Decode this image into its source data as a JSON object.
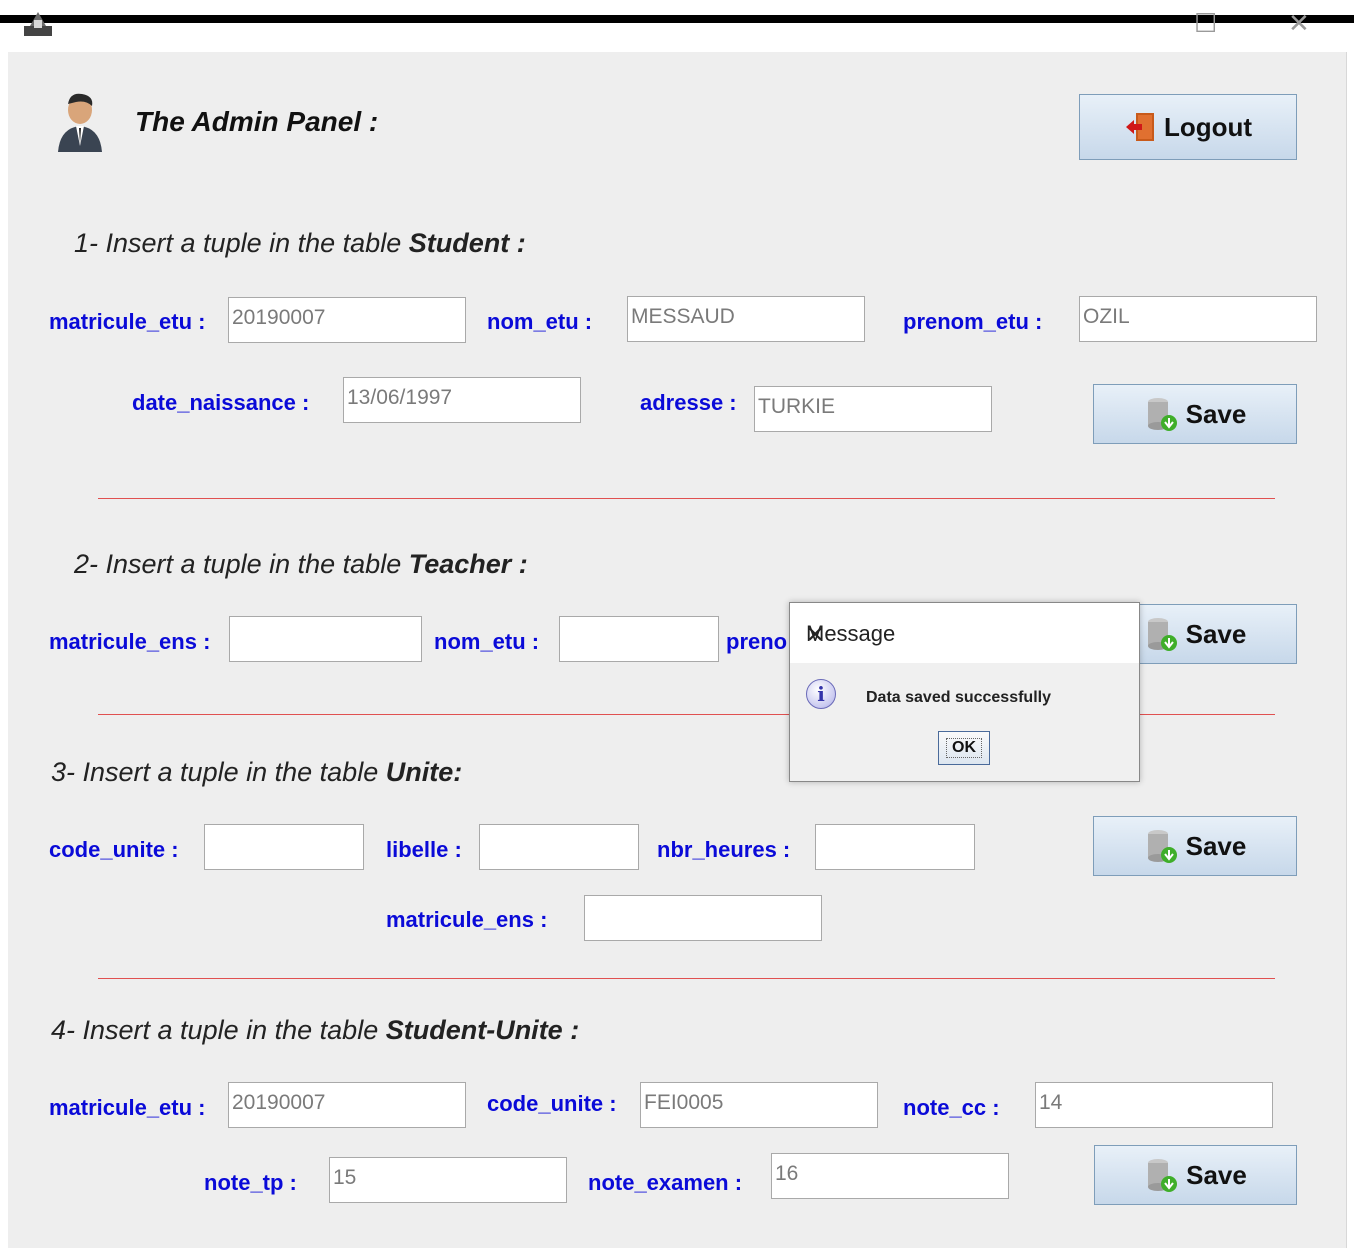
{
  "window": {
    "minimize_icon": "☐",
    "close_icon": "✕"
  },
  "header": {
    "title": "The Admin Panel  :",
    "logout_label": "Logout"
  },
  "student": {
    "section_prefix": "1- Insert a tuple in the table ",
    "section_table": "Student :",
    "matricule_label": "matricule_etu :",
    "matricule_value": "20190007",
    "nom_label": "nom_etu :",
    "nom_value": "MESSAUD",
    "prenom_label": "prenom_etu :",
    "prenom_value": "OZIL",
    "date_label": "date_naissance :",
    "date_value": "13/06/1997",
    "adresse_label": "adresse :",
    "adresse_value": "TURKIE",
    "save_label": "Save"
  },
  "teacher": {
    "section_prefix": "2- Insert a tuple in the table ",
    "section_table": "Teacher :",
    "matricule_label": "matricule_ens :",
    "matricule_value": "",
    "nom_label": "nom_etu :",
    "nom_value": "",
    "prenom_label_partial": "preno",
    "save_label": "Save"
  },
  "unite": {
    "section_prefix": "3- Insert a tuple in the table ",
    "section_table": "Unite:",
    "code_label": "code_unite :",
    "code_value": "",
    "libelle_label": "libelle :",
    "libelle_value": "",
    "nbr_label": "nbr_heures :",
    "nbr_value": "",
    "matricule_label": "matricule_ens :",
    "matricule_value": "",
    "save_label": "Save"
  },
  "student_unite": {
    "section_prefix": "4- Insert a tuple in the table ",
    "section_table": "Student-Unite :",
    "matricule_label": "matricule_etu :",
    "matricule_value": "20190007",
    "code_label": "code_unite :",
    "code_value": "FEI0005",
    "note_cc_label": "note_cc :",
    "note_cc_value": "14",
    "note_tp_label": "note_tp :",
    "note_tp_value": "15",
    "note_examen_label": "note_examen :",
    "note_examen_value": "16",
    "save_label": "Save"
  },
  "dialog": {
    "title": "Message",
    "close_icon": "✕",
    "info_icon": "i",
    "message": "Data saved successfully",
    "ok_label": "OK"
  },
  "colors": {
    "label": "#0a0ad8",
    "separator": "#e05050",
    "panel": "#eeeeee"
  }
}
